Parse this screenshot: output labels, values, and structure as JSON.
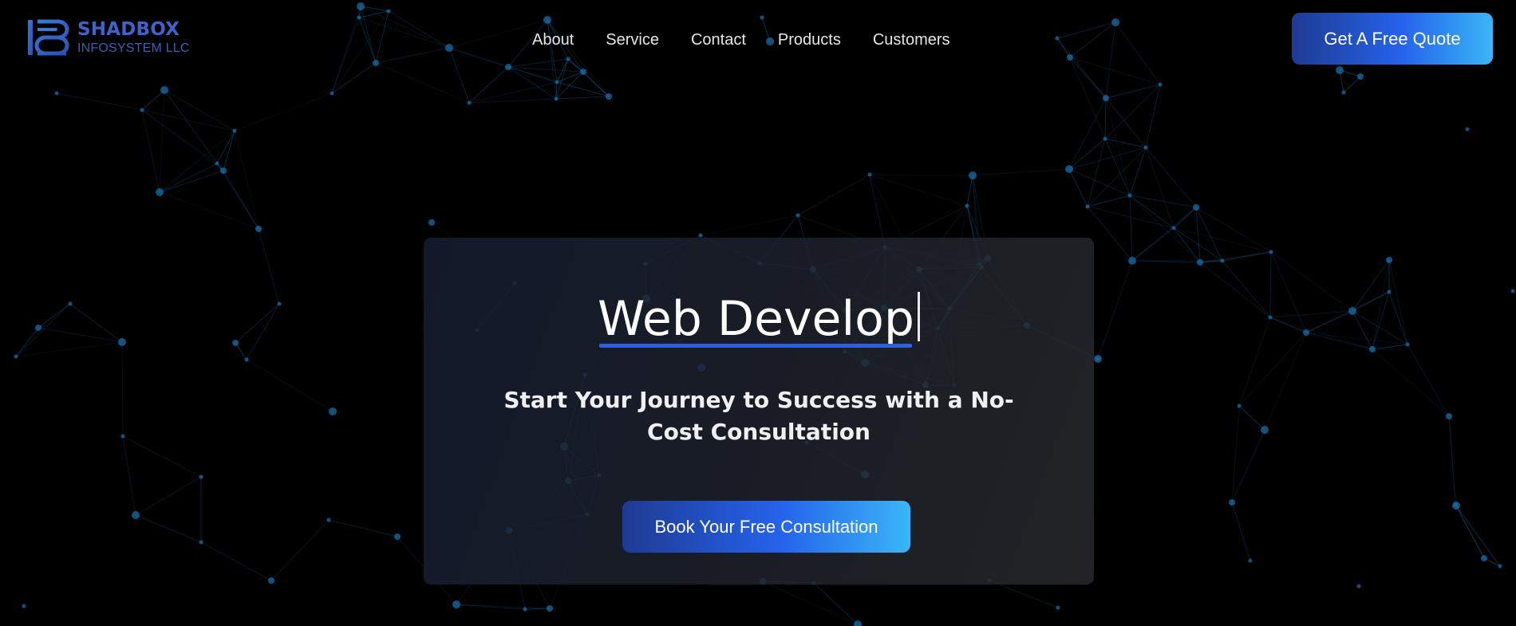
{
  "brand": {
    "name": "SHADBOX",
    "subtitle": "INFOSYSTEM LLC",
    "logo_icon": "sb-monogram-icon",
    "color": "#3f63c9"
  },
  "nav": {
    "items": [
      {
        "label": "About"
      },
      {
        "label": "Service"
      },
      {
        "label": "Contact"
      },
      {
        "label": "Products"
      },
      {
        "label": "Customers"
      }
    ]
  },
  "header": {
    "quote_button": "Get A Free Quote"
  },
  "hero": {
    "typed_text": "Web Develop",
    "tagline": "Start Your Journey to Success with a No-Cost Consultation",
    "cta_button": "Book Your Free Consultation"
  },
  "theme": {
    "background": "#000000",
    "accent_start": "#1f3a93",
    "accent_mid": "#2563eb",
    "accent_end": "#3bb6f7",
    "network_color": "#1a6da8"
  }
}
